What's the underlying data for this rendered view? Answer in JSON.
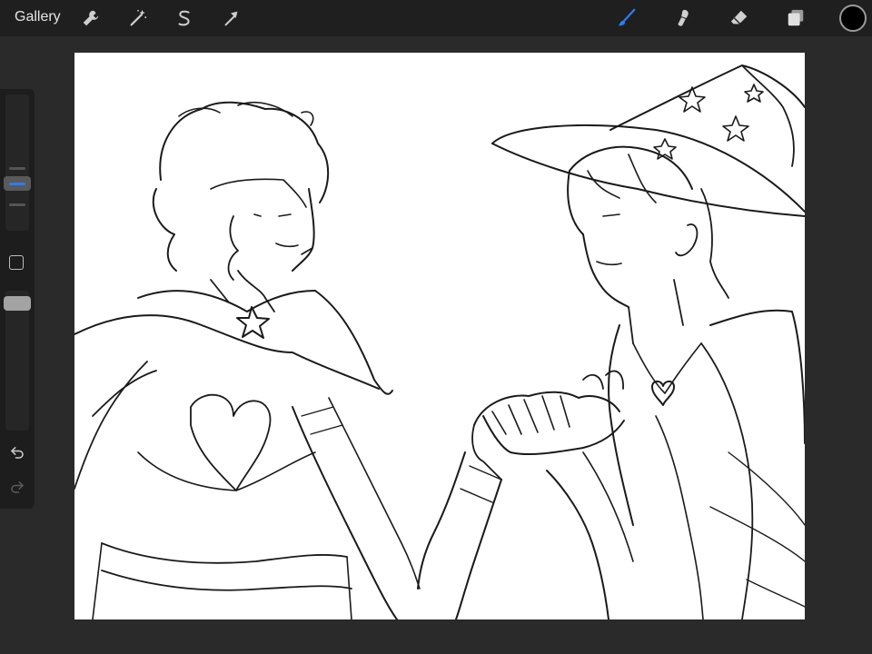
{
  "topbar": {
    "gallery_label": "Gallery",
    "left_tools": [
      {
        "name": "actions",
        "icon": "wrench-icon"
      },
      {
        "name": "adjustments",
        "icon": "magic-wand-icon"
      },
      {
        "name": "selection",
        "icon": "selection-s-icon"
      },
      {
        "name": "transform",
        "icon": "arrow-cursor-icon"
      }
    ],
    "right_tools": [
      {
        "name": "brush",
        "icon": "brush-icon",
        "active": true
      },
      {
        "name": "smudge",
        "icon": "smudge-icon",
        "active": false
      },
      {
        "name": "eraser",
        "icon": "eraser-icon",
        "active": false
      },
      {
        "name": "layers",
        "icon": "layers-icon",
        "active": false
      }
    ],
    "current_color": "#000000",
    "active_tool_color": "#2d7df6"
  },
  "sidebar": {
    "size_slider_icon": "brush-size-handle",
    "modify_icon": "square-icon",
    "opacity_slider_icon": "opacity-handle",
    "undo_icon": "undo-icon",
    "redo_icon": "redo-icon"
  },
  "canvas": {
    "background": "#ffffff",
    "content": "line-art-sketch"
  }
}
